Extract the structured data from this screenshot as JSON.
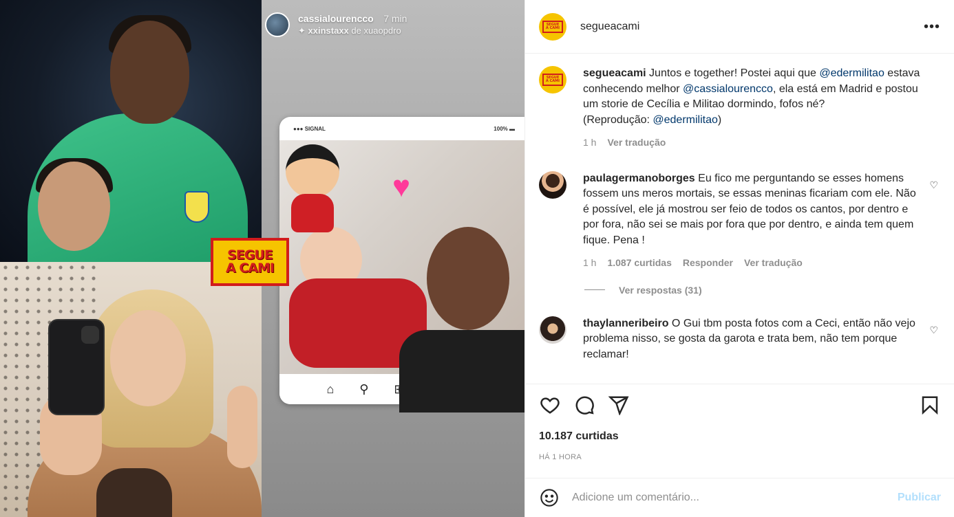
{
  "media": {
    "logo_line1": "SEGUE",
    "logo_line2": "A CAMI",
    "story": {
      "username": "cassialourencco",
      "time": "7 min",
      "music_user": "xxinstaxx",
      "music_rest": "de xuaopdro",
      "mock_status_left": "●●● SIGNAL",
      "mock_status_right": "100%"
    }
  },
  "post": {
    "username": "segueacami",
    "caption": {
      "username": "segueacami",
      "part1": " Juntos e together! Postei aqui que ",
      "mention1": "@edermilitao",
      "part2": " estava conhecendo melhor ",
      "mention2": "@cassialourencco",
      "part3": ", ela está em Madrid e postou um storie de Cecília e Militao dormindo, fofos né?",
      "part4": "(Reprodução: ",
      "mention3": "@edermilitao",
      "part5": ")",
      "time": "1 h",
      "translate": "Ver tradução"
    },
    "comments": [
      {
        "username": "paulagermanoborges",
        "text": " Eu fico me perguntando se esses homens fossem uns meros mortais, se essas meninas ficariam com ele. Não é possível, ele já mostrou ser feio de todos os cantos, por dentro e por fora, não sei se mais por fora que por dentro, e ainda tem quem fique. Pena !",
        "time": "1 h",
        "likes": "1.087 curtidas",
        "reply": "Responder",
        "translate": "Ver tradução",
        "view_replies": "Ver respostas (31)"
      },
      {
        "username": "thaylanneribeiro",
        "text": " O Gui tbm posta fotos com a Ceci, então não vejo problema nisso, se gosta da garota e trata bem, não tem porque reclamar!"
      }
    ],
    "likes": "10.187 curtidas",
    "posted": "HÁ 1 HORA",
    "comment_placeholder": "Adicione um comentário...",
    "publish": "Publicar"
  }
}
